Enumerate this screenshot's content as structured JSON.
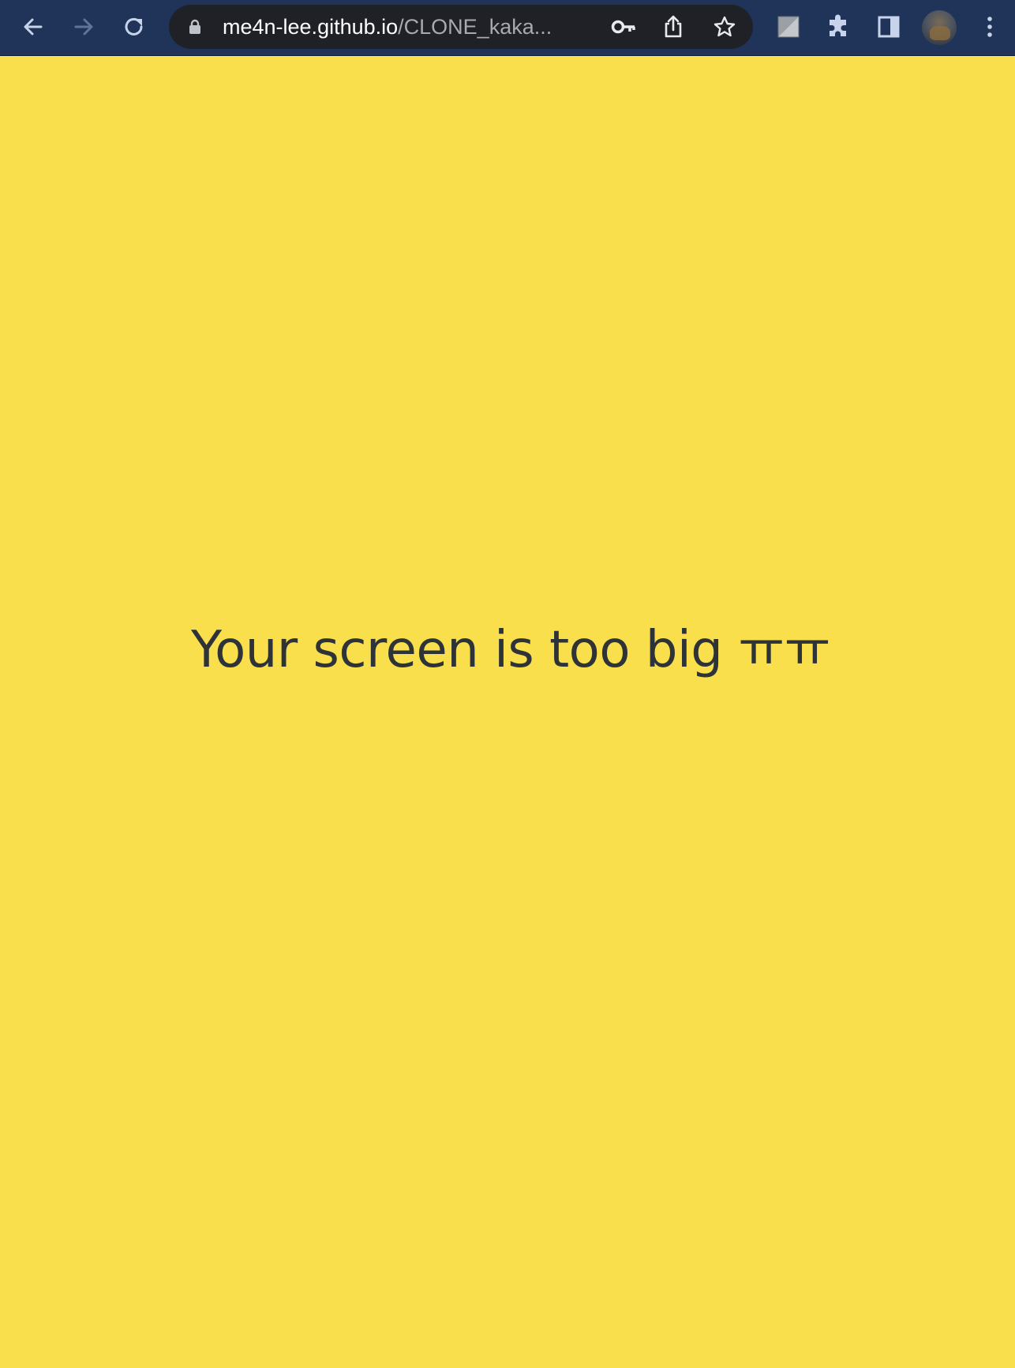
{
  "browser": {
    "url_host": "me4n-lee.github.io",
    "url_path": "/CLONE_kaka...",
    "icons": {
      "back": "back-arrow-icon",
      "forward": "forward-arrow-icon",
      "reload": "reload-icon",
      "lock": "lock-icon",
      "key": "password-key-icon",
      "share": "share-icon",
      "bookmark": "star-icon",
      "extension_square": "extension-icon",
      "extensions": "puzzle-icon",
      "side_panel": "side-panel-icon",
      "profile": "profile-avatar",
      "menu": "kebab-menu-icon"
    },
    "colors": {
      "toolbar": "#1f3458",
      "omnibox": "#1f2126"
    }
  },
  "page": {
    "message": "Your screen is too big ㅠㅠ",
    "background_color": "#f8df4b",
    "text_color": "#2e3337"
  }
}
